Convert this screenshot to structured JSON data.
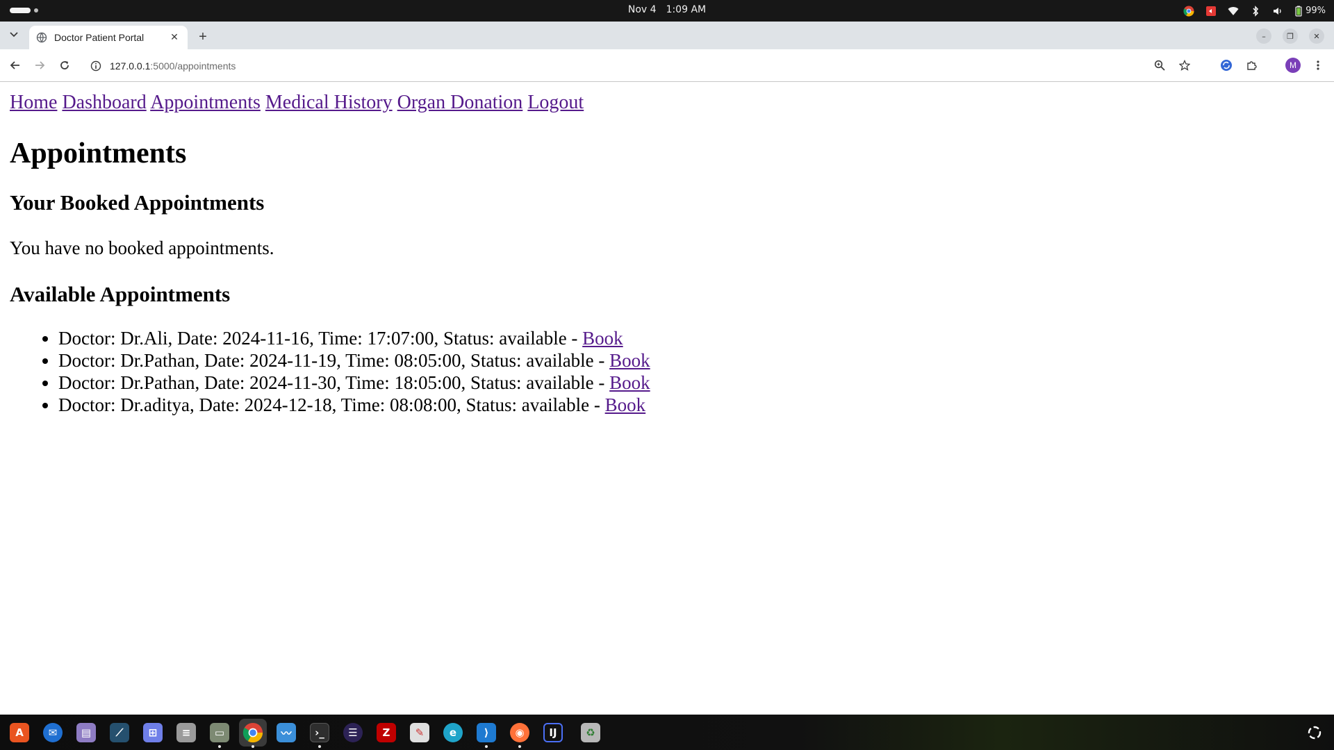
{
  "os": {
    "date": "Nov 4",
    "time": "1:09 AM",
    "battery": "99%"
  },
  "browser": {
    "tab_title": "Doctor Patient Portal",
    "url_host": "127.0.0.1",
    "url_path": ":5000/appointments",
    "profile_initial": "M"
  },
  "nav": {
    "home": "Home",
    "dashboard": "Dashboard",
    "appointments": "Appointments",
    "medical_history": "Medical History",
    "organ_donation": "Organ Donation",
    "logout": "Logout"
  },
  "page": {
    "title": "Appointments",
    "booked_heading": "Your Booked Appointments",
    "booked_empty": "You have no booked appointments.",
    "available_heading": "Available Appointments",
    "available": [
      {
        "text": "Doctor: Dr.Ali, Date: 2024-11-16, Time: 17:07:00, Status: available - ",
        "link": "Book"
      },
      {
        "text": "Doctor: Dr.Pathan, Date: 2024-11-19, Time: 08:05:00, Status: available - ",
        "link": "Book"
      },
      {
        "text": "Doctor: Dr.Pathan, Date: 2024-11-30, Time: 18:05:00, Status: available - ",
        "link": "Book"
      },
      {
        "text": "Doctor: Dr.aditya, Date: 2024-12-18, Time: 08:08:00, Status: available - ",
        "link": "Book"
      }
    ]
  },
  "dock": {
    "items": [
      "app-center-icon",
      "thunderbird-icon",
      "disk-utility-icon",
      "mysql-workbench-icon",
      "screenshot-tool-icon",
      "database-icon",
      "files-icon",
      "chrome-icon",
      "system-monitor-icon",
      "terminal-icon",
      "eclipse-icon",
      "filezilla-icon",
      "text-editor-icon",
      "edge-icon",
      "vscode-icon",
      "firefox-icon",
      "intellij-icon",
      "trash-icon",
      "show-apps-icon"
    ]
  },
  "colors": {
    "link_visited": "#551a8b",
    "os_bar": "#171717",
    "tabstrip": "#dfe3e7",
    "profile": "#7a3fb8"
  }
}
